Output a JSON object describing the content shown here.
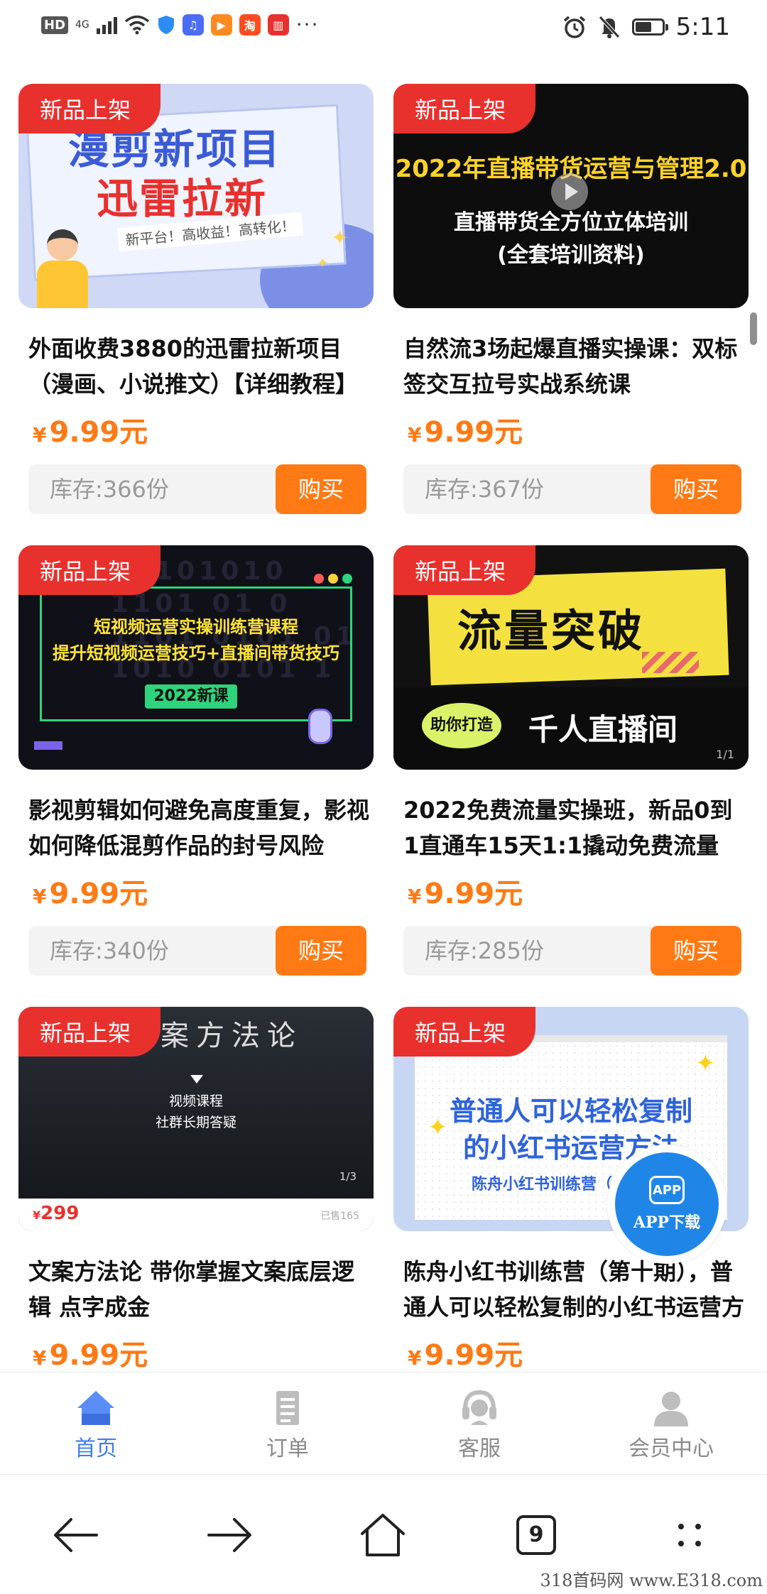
{
  "status_bar": {
    "hd": "HD",
    "signal": "4G",
    "time": "5:11",
    "more": "···",
    "battery_level": 0.62,
    "app_icons": [
      {
        "name": "music-app-icon",
        "glyph": "♫",
        "color": "#4a6cf7"
      },
      {
        "name": "video-app-icon",
        "glyph": "▶",
        "color": "#ff8a1f"
      },
      {
        "name": "taobao-app-icon",
        "glyph": "淘",
        "color": "#ff4b1f"
      },
      {
        "name": "book-app-icon",
        "glyph": "▥",
        "color": "#e8312d"
      }
    ]
  },
  "products": [
    {
      "badge": "新品上架",
      "title": "外面收费3880的迅雷拉新项目（漫画、小说推文）【详细教程】",
      "price_symbol": "¥",
      "price": "9.99元",
      "stock": "库存:366份",
      "buy": "购买",
      "thumb": {
        "line1": "漫剪新项目",
        "line2": "迅雷拉新",
        "line3": "新平台！高收益！高转化！"
      }
    },
    {
      "badge": "新品上架",
      "title": "自然流3场起爆直播实操课：双标签交互拉号实战系统课",
      "price_symbol": "¥",
      "price": "9.99元",
      "stock": "库存:367份",
      "buy": "购买",
      "thumb": {
        "line1": "2022年直播带货运营与管理2.0",
        "line2": "直播带货全方位立体培训",
        "line3": "(全套培训资料)"
      }
    },
    {
      "badge": "新品上架",
      "title": "影视剪辑如何避免高度重复，影视如何降低混剪作品的封号风险",
      "price_symbol": "¥",
      "price": "9.99元",
      "stock": "库存:340份",
      "buy": "购买",
      "thumb": {
        "line1": "短视频运营实操训练营课程",
        "line2": "提升短视频运营技巧+直播间带货技巧",
        "tag": "2022新课",
        "bg": "11101010 1101 01 0 1101 0101 01 1010 0101 1"
      }
    },
    {
      "badge": "新品上架",
      "title": "2022免费流量实操班，新品0到1直通车15天1:1撬动免费流量",
      "price_symbol": "¥",
      "price": "9.99元",
      "stock": "库存:285份",
      "buy": "购买",
      "thumb": {
        "line1": "流量突破",
        "bubble": "助你打造",
        "line2": "千人直播间",
        "page": "1/1"
      }
    },
    {
      "badge": "新品上架",
      "title": "文案方法论 带你掌握文案底层逻辑 点字成金",
      "price_symbol": "¥",
      "price": "9.99元",
      "thumb": {
        "line0": "案方法论",
        "line1": "视频课程",
        "line2": "社群长期答疑",
        "page": "1/3",
        "price_small_symbol": "¥",
        "price_small": "299",
        "sold": "已售165"
      }
    },
    {
      "badge": "新品上架",
      "title": "陈舟小红书训练营（第十期），普通人可以轻松复制的小红书运营方法",
      "price_symbol": "¥",
      "price": "9.99元",
      "thumb": {
        "line1": "普通人可以轻松复制",
        "line2": "的小红书运营方法",
        "line3": "陈舟小红书训练营（"
      }
    }
  ],
  "app_float": {
    "icon_text": "APP",
    "label": "APP下载"
  },
  "tabbar": [
    {
      "label": "首页",
      "active": true
    },
    {
      "label": "订单",
      "active": false
    },
    {
      "label": "客服",
      "active": false
    },
    {
      "label": "会员中心",
      "active": false
    }
  ],
  "sysnav": {
    "tab_count": "9"
  },
  "watermark": "318首码网 www.E318.com"
}
